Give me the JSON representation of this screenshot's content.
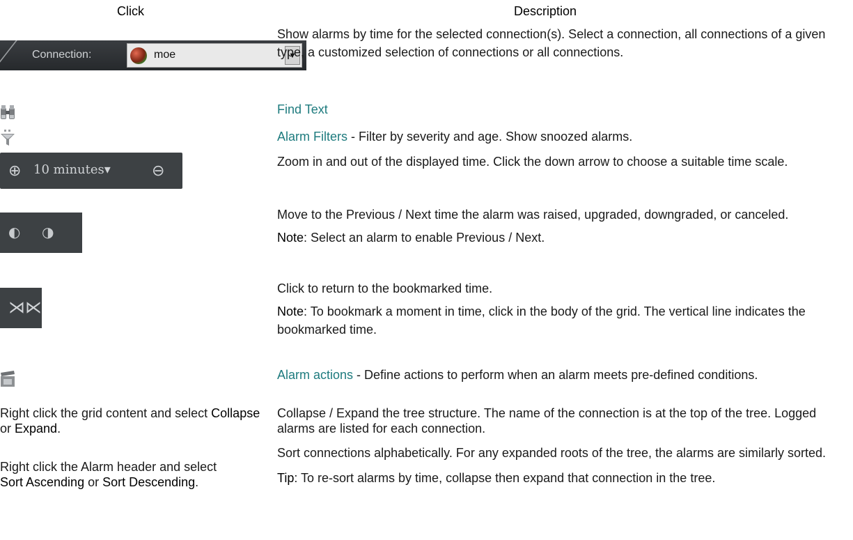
{
  "header": {
    "click": "Click",
    "description": "Description"
  },
  "connection": {
    "label": "Connection:",
    "value": "moe",
    "drop_glyph": "▼",
    "desc": "Show alarms by time for the selected connection(s). Select a connection, all connections of a given type, a customized selection of connections or all connections."
  },
  "find": {
    "icon": "binoculars-icon",
    "link": "Find Text"
  },
  "filters": {
    "icon": "filter-icon",
    "link": "Alarm Filters",
    "rest": " - Filter by severity and age. Show snoozed alarms."
  },
  "zoom": {
    "zoom_in_glyph": "⊕",
    "zoom_out_glyph": "⊖",
    "value": "10 minutes",
    "caret": "▾",
    "desc": "Zoom in and out of the displayed time. Click the down arrow to choose a suitable time scale."
  },
  "prevnext": {
    "prev_glyph": "◐",
    "next_glyph": "◑",
    "desc": "Move to the Previous / Next time the alarm was raised, upgraded, downgraded, or canceled.",
    "note_label": "Note",
    "note_text": ": Select an alarm to enable Previous / Next."
  },
  "bookmark": {
    "glyph": "⋊⋉",
    "desc": "Click to return to the bookmarked time.",
    "note_label": "Note",
    "note_text": ": To bookmark a moment in time, click in the body of the grid. The vertical line indicates the bookmarked time."
  },
  "actions": {
    "icon": "clapperboard-icon",
    "link": "Alarm actions",
    "rest": " - Define actions to perform when an alarm meets pre-defined conditions."
  },
  "collapse": {
    "click_a": "Right click the grid content and select ",
    "click_b": "Collapse",
    "click_c": " or ",
    "click_d": "Expand",
    "click_e": ".",
    "desc": "Collapse / Expand the tree structure. The name of the connection is at the top of the tree. Logged alarms are listed for each connection."
  },
  "sort": {
    "click_a": "Right click the Alarm header and select ",
    "click_b": "Sort Ascending",
    "click_c": " or ",
    "click_d": "Sort Descending",
    "click_e": ".",
    "desc": "Sort connections alphabetically. For any expanded roots of the tree, the alarms are similarly sorted.",
    "tip_label": "Tip",
    "tip_text": ": To re-sort alarms by time, collapse then expand that connection in the tree."
  }
}
